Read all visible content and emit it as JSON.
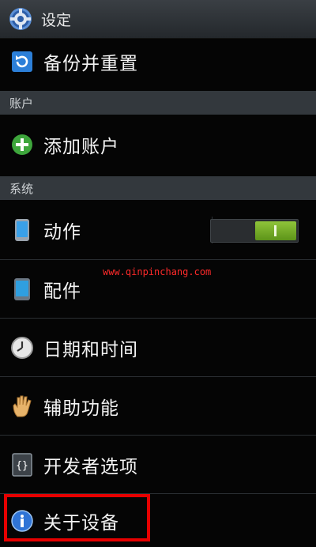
{
  "appbar": {
    "title": "设定",
    "icon": "gear-icon"
  },
  "items": {
    "backup_reset": "备份并重置",
    "add_account": "添加账户",
    "motion": "动作",
    "accessory": "配件",
    "date_time": "日期和时间",
    "accessibility": "辅助功能",
    "developer_options": "开发者选项",
    "about_device": "关于设备"
  },
  "sections": {
    "accounts": "账户",
    "system": "系统"
  },
  "motion_toggle": {
    "state": "on",
    "knob_label": "I"
  },
  "watermark": "www.qinpinchang.com",
  "colors": {
    "accent_green": "#6ea623",
    "highlight_red": "#e60000",
    "header_bg": "#33383d"
  }
}
